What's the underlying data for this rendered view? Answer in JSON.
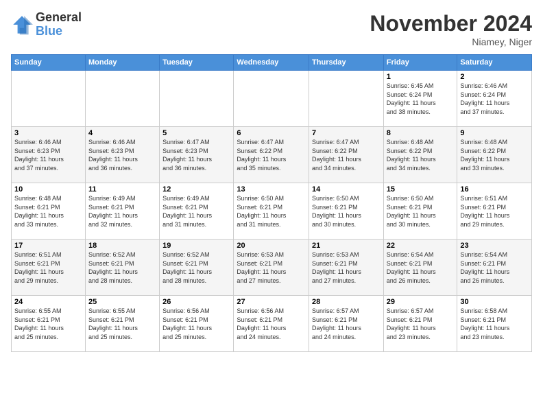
{
  "logo": {
    "general": "General",
    "blue": "Blue"
  },
  "title": "November 2024",
  "location": "Niamey, Niger",
  "days_header": [
    "Sunday",
    "Monday",
    "Tuesday",
    "Wednesday",
    "Thursday",
    "Friday",
    "Saturday"
  ],
  "weeks": [
    [
      {
        "day": "",
        "info": ""
      },
      {
        "day": "",
        "info": ""
      },
      {
        "day": "",
        "info": ""
      },
      {
        "day": "",
        "info": ""
      },
      {
        "day": "",
        "info": ""
      },
      {
        "day": "1",
        "info": "Sunrise: 6:45 AM\nSunset: 6:24 PM\nDaylight: 11 hours\nand 38 minutes."
      },
      {
        "day": "2",
        "info": "Sunrise: 6:46 AM\nSunset: 6:24 PM\nDaylight: 11 hours\nand 37 minutes."
      }
    ],
    [
      {
        "day": "3",
        "info": "Sunrise: 6:46 AM\nSunset: 6:23 PM\nDaylight: 11 hours\nand 37 minutes."
      },
      {
        "day": "4",
        "info": "Sunrise: 6:46 AM\nSunset: 6:23 PM\nDaylight: 11 hours\nand 36 minutes."
      },
      {
        "day": "5",
        "info": "Sunrise: 6:47 AM\nSunset: 6:23 PM\nDaylight: 11 hours\nand 36 minutes."
      },
      {
        "day": "6",
        "info": "Sunrise: 6:47 AM\nSunset: 6:22 PM\nDaylight: 11 hours\nand 35 minutes."
      },
      {
        "day": "7",
        "info": "Sunrise: 6:47 AM\nSunset: 6:22 PM\nDaylight: 11 hours\nand 34 minutes."
      },
      {
        "day": "8",
        "info": "Sunrise: 6:48 AM\nSunset: 6:22 PM\nDaylight: 11 hours\nand 34 minutes."
      },
      {
        "day": "9",
        "info": "Sunrise: 6:48 AM\nSunset: 6:22 PM\nDaylight: 11 hours\nand 33 minutes."
      }
    ],
    [
      {
        "day": "10",
        "info": "Sunrise: 6:48 AM\nSunset: 6:21 PM\nDaylight: 11 hours\nand 33 minutes."
      },
      {
        "day": "11",
        "info": "Sunrise: 6:49 AM\nSunset: 6:21 PM\nDaylight: 11 hours\nand 32 minutes."
      },
      {
        "day": "12",
        "info": "Sunrise: 6:49 AM\nSunset: 6:21 PM\nDaylight: 11 hours\nand 31 minutes."
      },
      {
        "day": "13",
        "info": "Sunrise: 6:50 AM\nSunset: 6:21 PM\nDaylight: 11 hours\nand 31 minutes."
      },
      {
        "day": "14",
        "info": "Sunrise: 6:50 AM\nSunset: 6:21 PM\nDaylight: 11 hours\nand 30 minutes."
      },
      {
        "day": "15",
        "info": "Sunrise: 6:50 AM\nSunset: 6:21 PM\nDaylight: 11 hours\nand 30 minutes."
      },
      {
        "day": "16",
        "info": "Sunrise: 6:51 AM\nSunset: 6:21 PM\nDaylight: 11 hours\nand 29 minutes."
      }
    ],
    [
      {
        "day": "17",
        "info": "Sunrise: 6:51 AM\nSunset: 6:21 PM\nDaylight: 11 hours\nand 29 minutes."
      },
      {
        "day": "18",
        "info": "Sunrise: 6:52 AM\nSunset: 6:21 PM\nDaylight: 11 hours\nand 28 minutes."
      },
      {
        "day": "19",
        "info": "Sunrise: 6:52 AM\nSunset: 6:21 PM\nDaylight: 11 hours\nand 28 minutes."
      },
      {
        "day": "20",
        "info": "Sunrise: 6:53 AM\nSunset: 6:21 PM\nDaylight: 11 hours\nand 27 minutes."
      },
      {
        "day": "21",
        "info": "Sunrise: 6:53 AM\nSunset: 6:21 PM\nDaylight: 11 hours\nand 27 minutes."
      },
      {
        "day": "22",
        "info": "Sunrise: 6:54 AM\nSunset: 6:21 PM\nDaylight: 11 hours\nand 26 minutes."
      },
      {
        "day": "23",
        "info": "Sunrise: 6:54 AM\nSunset: 6:21 PM\nDaylight: 11 hours\nand 26 minutes."
      }
    ],
    [
      {
        "day": "24",
        "info": "Sunrise: 6:55 AM\nSunset: 6:21 PM\nDaylight: 11 hours\nand 25 minutes."
      },
      {
        "day": "25",
        "info": "Sunrise: 6:55 AM\nSunset: 6:21 PM\nDaylight: 11 hours\nand 25 minutes."
      },
      {
        "day": "26",
        "info": "Sunrise: 6:56 AM\nSunset: 6:21 PM\nDaylight: 11 hours\nand 25 minutes."
      },
      {
        "day": "27",
        "info": "Sunrise: 6:56 AM\nSunset: 6:21 PM\nDaylight: 11 hours\nand 24 minutes."
      },
      {
        "day": "28",
        "info": "Sunrise: 6:57 AM\nSunset: 6:21 PM\nDaylight: 11 hours\nand 24 minutes."
      },
      {
        "day": "29",
        "info": "Sunrise: 6:57 AM\nSunset: 6:21 PM\nDaylight: 11 hours\nand 23 minutes."
      },
      {
        "day": "30",
        "info": "Sunrise: 6:58 AM\nSunset: 6:21 PM\nDaylight: 11 hours\nand 23 minutes."
      }
    ]
  ]
}
